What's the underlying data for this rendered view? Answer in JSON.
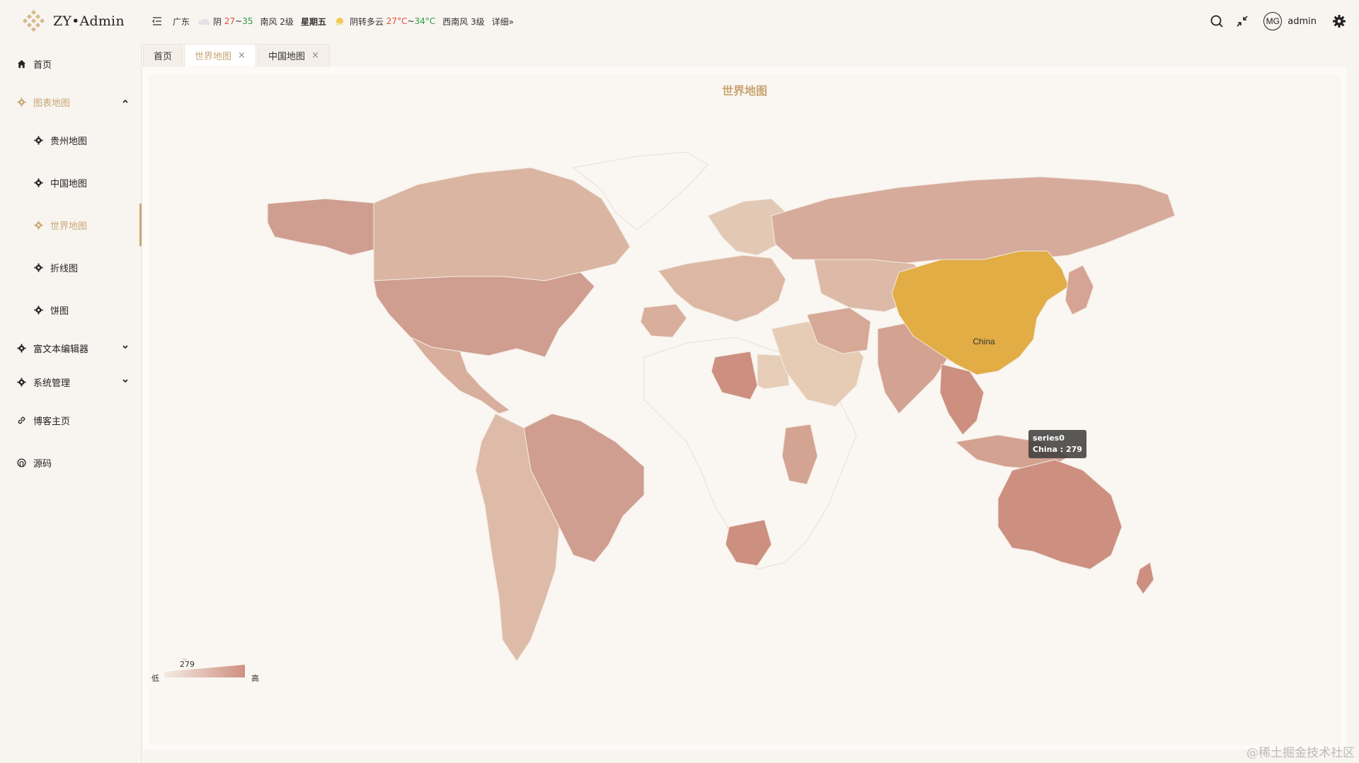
{
  "app": {
    "name": "ZY•Admin"
  },
  "weather": {
    "location": "广东",
    "today": {
      "condition": "阴",
      "low": "27",
      "sep": "~",
      "high": "35",
      "wind": "南风 2级",
      "weekday": "星期五"
    },
    "tomorrow": {
      "condition": "阴转多云",
      "low": "27°C",
      "sep": "~",
      "high": "34°C",
      "wind": "西南风 3级"
    },
    "detail_link": "详细»"
  },
  "user": {
    "avatar_text": "MG",
    "name": "admin"
  },
  "sidebar": {
    "items": [
      {
        "label": "首页",
        "icon": "home-icon"
      },
      {
        "label": "图表地图",
        "icon": "gear-icon",
        "expanded": true
      },
      {
        "label": "贵州地图",
        "icon": "gear-icon"
      },
      {
        "label": "中国地图",
        "icon": "gear-icon"
      },
      {
        "label": "世界地图",
        "icon": "gear-icon",
        "active": true
      },
      {
        "label": "折线图",
        "icon": "gear-icon"
      },
      {
        "label": "饼图",
        "icon": "gear-icon"
      },
      {
        "label": "富文本编辑器",
        "icon": "gear-icon"
      },
      {
        "label": "系统管理",
        "icon": "gear-icon"
      },
      {
        "label": "博客主页",
        "icon": "link-icon"
      },
      {
        "label": "源码",
        "icon": "github-icon"
      }
    ]
  },
  "tabs": [
    {
      "label": "首页"
    },
    {
      "label": "世界地图",
      "active": true,
      "close": "×"
    },
    {
      "label": "中国地图",
      "close": "×"
    }
  ],
  "chart": {
    "title": "世界地图",
    "highlight_label": "China",
    "tooltip": {
      "series": "series0",
      "text": "China : 279"
    },
    "visual_map": {
      "low": "低",
      "high": "高",
      "value": "279"
    }
  },
  "chart_data": {
    "type": "map",
    "title": "世界地图",
    "series": [
      {
        "name": "series0",
        "values": [
          {
            "name": "China",
            "value": 279
          }
        ]
      }
    ],
    "visual_map": {
      "low_label": "低",
      "high_label": "高",
      "current": 279
    },
    "colors": {
      "low": "#f2e6dc",
      "high": "#cf8f80",
      "highlight": "#e2ad45"
    }
  },
  "watermark": "@稀土掘金技术社区"
}
